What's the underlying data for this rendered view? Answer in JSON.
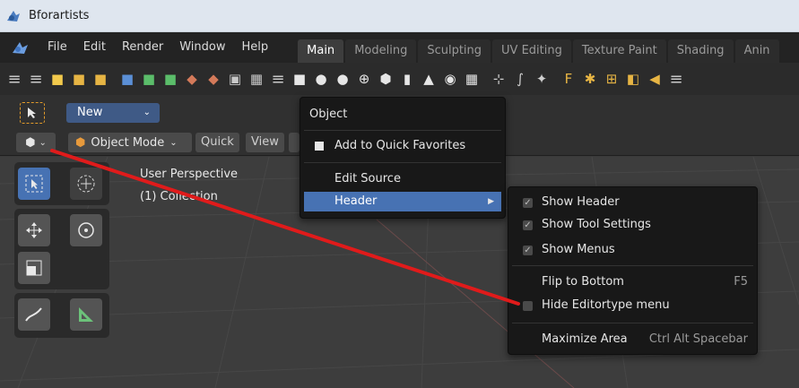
{
  "window": {
    "title": "Bforartists"
  },
  "menubar": {
    "items": [
      "File",
      "Edit",
      "Render",
      "Window",
      "Help"
    ],
    "tabs": [
      {
        "label": "Main",
        "active": true
      },
      {
        "label": "Modeling",
        "active": false
      },
      {
        "label": "Sculpting",
        "active": false
      },
      {
        "label": "UV Editing",
        "active": false
      },
      {
        "label": "Texture Paint",
        "active": false
      },
      {
        "label": "Shading",
        "active": false
      },
      {
        "label": "Anin",
        "active": false
      }
    ]
  },
  "header": {
    "new_label": "New",
    "mode_label": "Object Mode",
    "quick_label": "Quick",
    "view_label": "View"
  },
  "viewport": {
    "perspective": "User Perspective",
    "collection": "(1) Collection"
  },
  "context_menu": {
    "title": "Object",
    "add_favorites": "Add to Quick Favorites",
    "edit_source": "Edit Source",
    "header": "Header"
  },
  "sub_menu": {
    "show_header": "Show Header",
    "show_tool_settings": "Show Tool Settings",
    "show_menus": "Show Menus",
    "flip_to_bottom": "Flip to Bottom",
    "flip_shortcut": "F5",
    "hide_editortype": "Hide Editortype menu",
    "maximize_area": "Maximize Area",
    "maximize_shortcut": "Ctrl Alt Spacebar"
  },
  "colors": {
    "accent": "#4772b3",
    "annotation_line": "#e01b1b",
    "selection_outline": "#e39b2a"
  }
}
